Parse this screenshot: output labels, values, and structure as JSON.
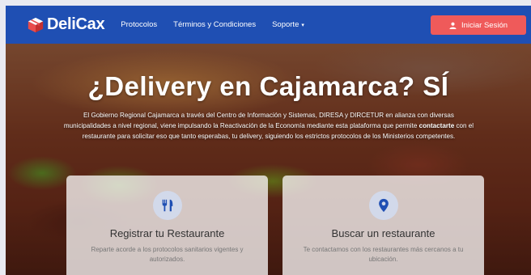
{
  "brand": {
    "name": "DeliCax",
    "icon": "box-icon"
  },
  "nav": {
    "links": [
      {
        "label": "Protocolos"
      },
      {
        "label": "Términos y Condiciones"
      },
      {
        "label": "Soporte",
        "caret": "▾"
      }
    ],
    "login_label": "Iniciar Sesión",
    "login_icon": "user-icon"
  },
  "hero": {
    "title": "¿Delivery en Cajamarca?  SÍ",
    "text_before": "El Gobierno Regional Cajamarca a través del Centro de Información y Sistemas, DIRESA y DIRCETUR en alianza con diversas municipalidades a nivel regional, viene impulsando la Reactivación de la Economía mediante esta plataforma que permite ",
    "text_bold": "contactarte",
    "text_after": " con el restaurante para solicitar eso que tanto esperabas, tu delivery, siguiendo los estrictos protocolos de los Ministerios competentes."
  },
  "cards": [
    {
      "icon": "utensils-icon",
      "title": "Registrar tu Restaurante",
      "text": "Reparte acorde a los protocolos sanitarios vigentes y autorizados."
    },
    {
      "icon": "map-marker-icon",
      "title": "Buscar un restaurante",
      "text": "Te contactamos con los restaurantes más cercanos a tu ubicación."
    }
  ],
  "colors": {
    "navbar": "#1f4fb3",
    "login_button": "#ef5a5a",
    "icon_blue": "#1f4fb3"
  }
}
